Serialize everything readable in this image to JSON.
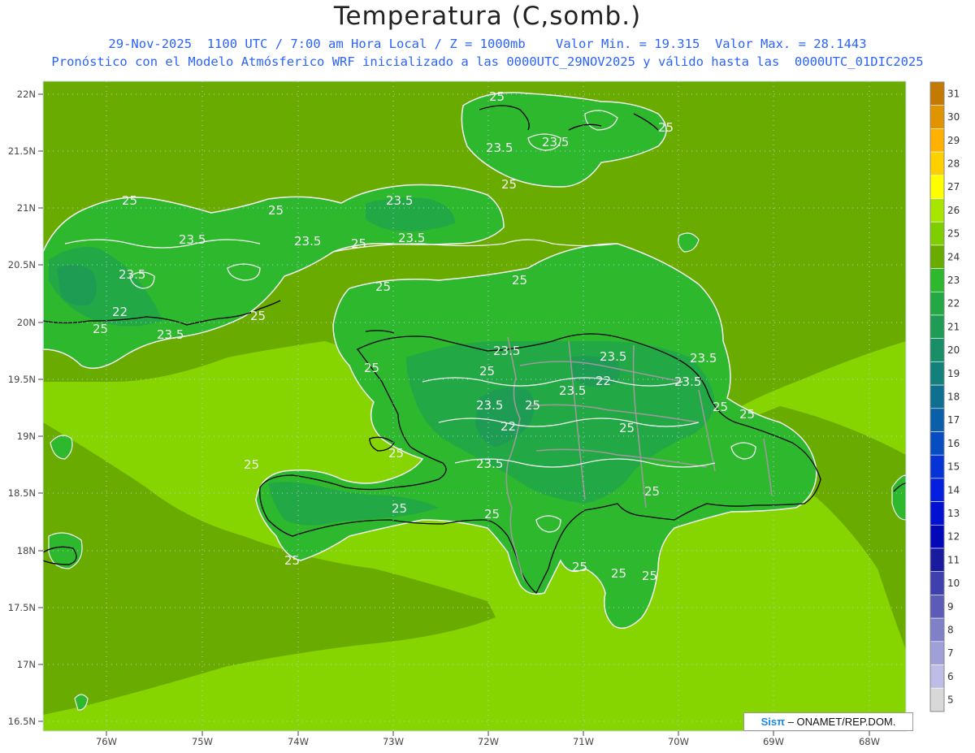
{
  "header": {
    "title": "Temperatura (C,somb.)",
    "subtitle_1": "29-Nov-2025  1100 UTC / 7:00 am Hora Local / Z = 1000mb    Valor Min. = 19.315  Valor Max. = 28.1443",
    "subtitle_2": "Pronóstico con el Modelo Atmósferico WRF inicializado a las 0000UTC_29NOV2025 y válido hasta las  0000UTC_01DIC2025"
  },
  "axes": {
    "lat_labels": [
      "22N",
      "21.5N",
      "21N",
      "20.5N",
      "20N",
      "19.5N",
      "19N",
      "18.5N",
      "18N",
      "17.5N",
      "17N",
      "16.5N"
    ],
    "lat_values": [
      22,
      21.5,
      21,
      20.5,
      20,
      19.5,
      19,
      18.5,
      18,
      17.5,
      17,
      16.5
    ],
    "lon_labels": [
      "76W",
      "75W",
      "74W",
      "73W",
      "72W",
      "71W",
      "70W",
      "69W",
      "68W"
    ],
    "lon_values": [
      -76,
      -75,
      -74,
      -73,
      -72,
      -71,
      -70,
      -69,
      -68
    ]
  },
  "legend": {
    "labels": [
      "31",
      "30",
      "29",
      "28",
      "27",
      "26",
      "25",
      "24",
      "23",
      "22",
      "21",
      "20",
      "19",
      "18",
      "17",
      "16",
      "15",
      "14",
      "13",
      "12",
      "11",
      "10",
      "9",
      "8",
      "7",
      "6",
      "5"
    ],
    "colors": [
      "#c47a00",
      "#e09400",
      "#ffb000",
      "#ffd000",
      "#ffff00",
      "#a8e600",
      "#7fcf00",
      "#6aab00",
      "#2eb82e",
      "#22a845",
      "#1f9c54",
      "#188f68",
      "#13807c",
      "#0f6f8f",
      "#0b5fa8",
      "#084cc2",
      "#0633d6",
      "#041fe0",
      "#0210d1",
      "#0208b8",
      "#1a1a9e",
      "#3f3fae",
      "#5c5cb8",
      "#8080c8",
      "#a0a0d8",
      "#bdbde5",
      "#d8d8d8"
    ]
  },
  "contour_labels": [
    "25",
    "23.5",
    "25",
    "25",
    "23.5",
    "23.5",
    "25",
    "25",
    "23.5",
    "23.5",
    "25",
    "23.5",
    "25",
    "22",
    "25",
    "23.5",
    "25",
    "25",
    "23.5",
    "23.5",
    "22",
    "23.5",
    "25",
    "23.5",
    "23.5",
    "25",
    "23.5",
    "25",
    "22",
    "23.5",
    "25",
    "25",
    "23.5",
    "25",
    "25",
    "25",
    "25",
    "25",
    "25",
    "25",
    "25",
    "25",
    "25"
  ],
  "credit": {
    "logo": "Sisπ",
    "text": "– ONAMET/REP.DOM."
  }
}
